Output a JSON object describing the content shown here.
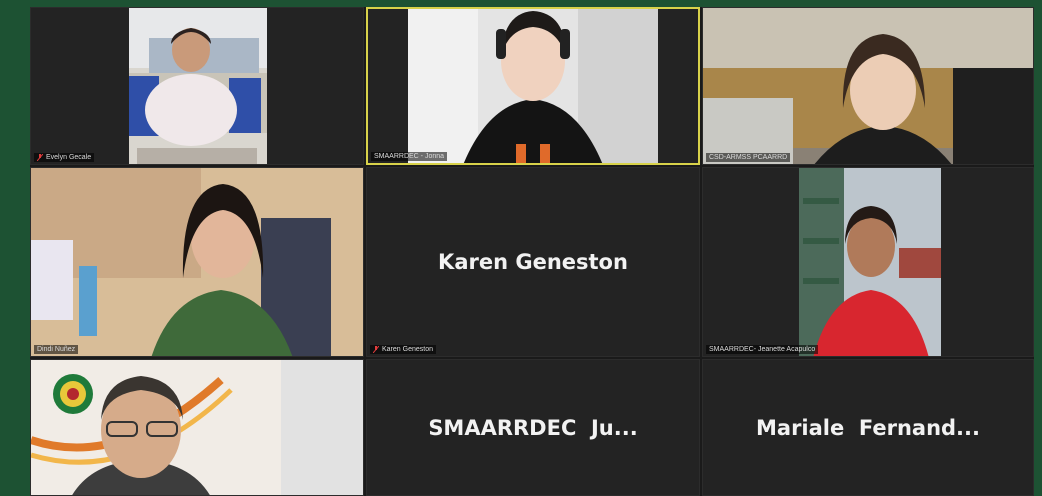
{
  "meeting": {
    "participants": [
      {
        "name": "Evelyn Gecale",
        "muted": true
      },
      {
        "name": "SMAARRDEC - Jonna",
        "muted": false
      },
      {
        "name": "CSD-ARMSS PCAARRD",
        "muted": false
      },
      {
        "name": "Dindi Nuñez",
        "muted": false
      },
      {
        "name": "Karen Geneston",
        "muted": true
      },
      {
        "name": "SMAARRDEC- Jeanette Acapulco",
        "muted": false
      },
      {
        "name": "",
        "muted": false
      },
      {
        "name": "SMAARRDEC  Ju...",
        "muted": false
      },
      {
        "name": "Mariale  Fernand...",
        "muted": false
      }
    ],
    "name_only_tiles": {
      "karen": "Karen Geneston",
      "smaarrdec": "SMAARRDEC  Ju...",
      "mariale": "Mariale  Fernand..."
    }
  },
  "colors": {
    "background": "#1d5233",
    "tile": "#232323",
    "active_speaker_border": "#d8d24a",
    "muted_icon": "#e23c3c"
  }
}
